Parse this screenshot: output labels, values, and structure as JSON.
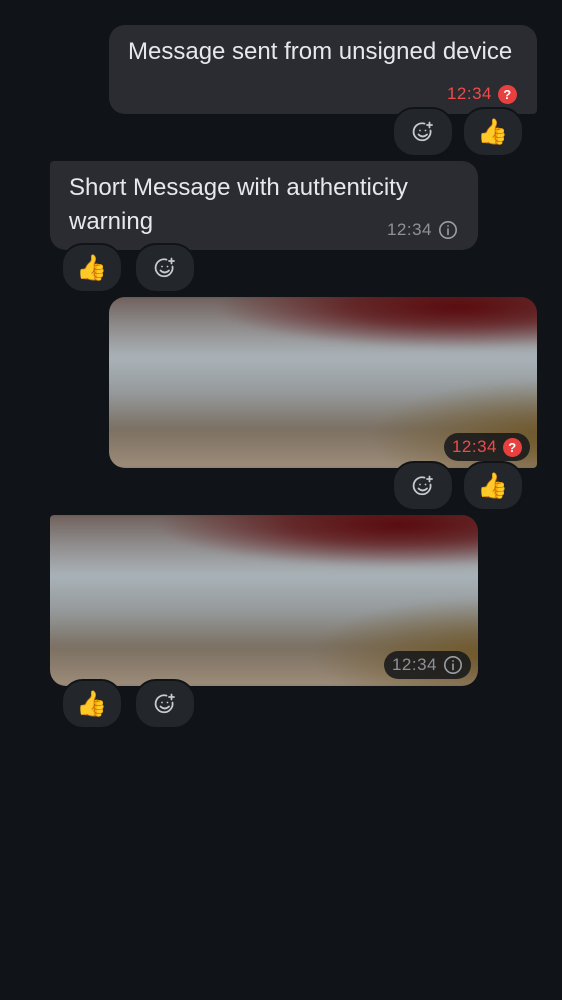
{
  "messages": [
    {
      "text": "Message sent from unsigned device",
      "time": "12:34",
      "status_icon": "question-mark-icon",
      "status_color": "#E8403F",
      "reaction": "👍"
    },
    {
      "text": "Short Message with authenticity warning",
      "time": "12:34",
      "status_icon": "info-icon",
      "reaction": "👍"
    },
    {
      "image": "blurred-image",
      "time": "12:34",
      "status_icon": "question-mark-icon",
      "status_color": "#E8403F",
      "reaction": "👍"
    },
    {
      "image": "blurred-image",
      "time": "12:34",
      "status_icon": "info-icon",
      "reaction": "👍"
    }
  ],
  "add_reaction_icon": "add-reaction-icon",
  "colors": {
    "background": "#101317",
    "bubble": "#2A2C31",
    "warning": "#F04A4A",
    "reaction_chip": "#23262B"
  }
}
